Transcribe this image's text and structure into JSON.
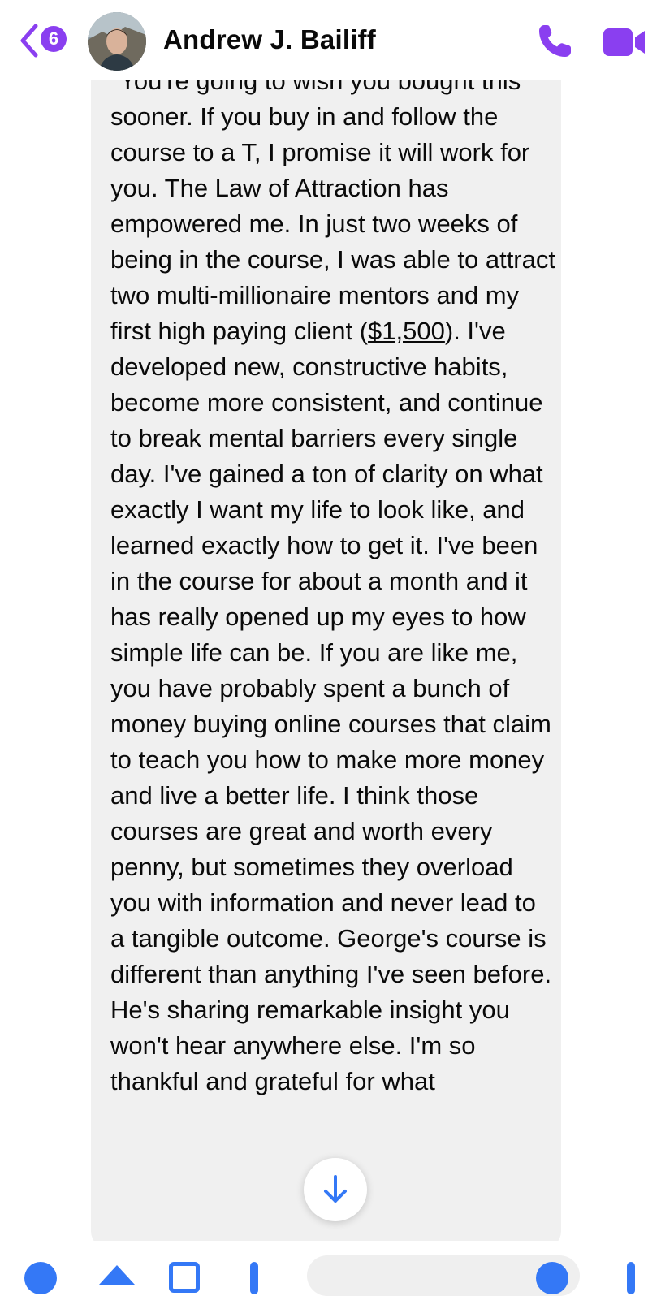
{
  "header": {
    "back_badge_count": "6",
    "contact_name": "Andrew J. Bailiff",
    "accent_color": "#8a3ff0"
  },
  "message": {
    "text_before_link": "\"You're going to wish you bought this sooner. If you buy in and follow the course to a T, I promise it will work for you. The Law of Attraction has empowered me. In just two weeks of being in the course, I was able to attract two multi-millionaire mentors and my first high paying client (",
    "link_text": "$1,500",
    "text_after_link": "). I've developed new, constructive habits, become more consistent, and continue to break mental barriers every single day. I've gained a ton of clarity on what exactly I want my life to look like, and learned exactly how to get it. I've been in the course for about a month and it has really opened up my eyes to how simple life can be. If you are like me, you have probably spent a bunch of money buying online courses that claim to teach you how to make more money and live a better life. I think those courses are great and worth every penny, but sometimes they overload you with information and never lead to a tangible outcome. George's course is different than anything I've seen before. He's sharing remarkable insight you won't hear anywhere else. I'm so thankful and grateful for what"
  },
  "icons": {
    "back": "chevron-left-icon",
    "call": "phone-icon",
    "video": "video-camera-icon",
    "scroll": "arrow-down-icon"
  }
}
